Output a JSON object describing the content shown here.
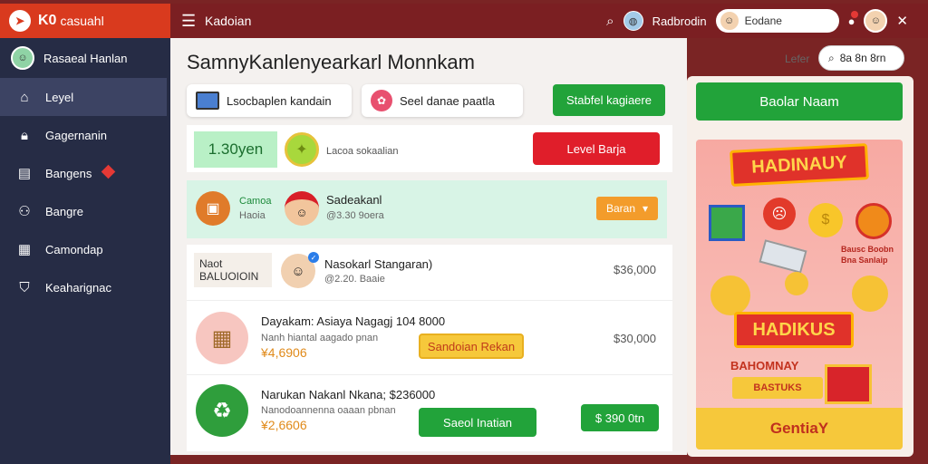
{
  "colors": {
    "topbar": "#7b1f22",
    "logo_bg": "#d93a1e",
    "sidebar": "#262c45",
    "green": "#22a33a",
    "red": "#e01e2a",
    "orange": "#f39c2b",
    "yellow": "#f6c83b"
  },
  "topbar": {
    "logo_mark": "K0",
    "app_name": "casuahl",
    "menu_icon": "menu-icon",
    "breadcrumb": "Kadoian",
    "search_icon": "search-icon",
    "global_user": "Radbrodin",
    "user_pill": "Eodane",
    "close_icon": "close-icon"
  },
  "sidebar": {
    "user": "Rasaeal Hanlan",
    "items": [
      {
        "label": "Leyel",
        "icon": "home-icon",
        "active": true
      },
      {
        "label": "Gagernanin",
        "icon": "lock-icon"
      },
      {
        "label": "Bangens",
        "icon": "book-icon",
        "badge": true
      },
      {
        "label": "Bangre",
        "icon": "users-icon"
      },
      {
        "label": "Camondap",
        "icon": "calendar-icon"
      },
      {
        "label": "Keaharignac",
        "icon": "shield-icon"
      }
    ]
  },
  "main": {
    "title": "SamnyKanlenyearkarl Monnkam",
    "header_link": "Lefer",
    "header_search": "8a 8n 8rn",
    "chips": [
      "Lsocbaplen kandain",
      "Seel danae paatla"
    ],
    "chip_button": "Stabfel kagiaere",
    "level_card": {
      "amount": "1.30yen",
      "label": "Lacoa sokaalian",
      "button": "Level Barja"
    },
    "featured": {
      "tag": "Camoa",
      "sub": "Haoia",
      "name": "Sadeakanl",
      "meta": "@3.30 9oera",
      "select": "Baran"
    },
    "rows": [
      {
        "badge": "Naot BALUOIOIN",
        "name": "Nasokarl Stangaran)",
        "meta": "@2.20. Baaie",
        "price": "$36,000"
      },
      {
        "title": "Dayakam: Asiaya Nagagj 104 8000",
        "sub": "Nanh hiantal aagado pnan",
        "amount": "¥4,6906",
        "button": "Sandoian Rekan",
        "price": "$30,000"
      },
      {
        "title": "Narukan Nakanl Nkana; $236000",
        "sub": "Nanodoannenna oaaan pbnan",
        "amount": "¥2,6606",
        "button": "Saeol Inatian",
        "action": "$ 390 0tn"
      }
    ]
  },
  "right": {
    "top_button": "Baolar Naam",
    "promo": {
      "headline": "HADINAUY",
      "side_text_1": "Bausc Boobn",
      "side_text_2": "Bna Sanlaip",
      "mid_banner": "HADIKUS",
      "caption": "BAHOMNAY",
      "tag": "BASTUKS",
      "cta": "GentiaY"
    }
  }
}
